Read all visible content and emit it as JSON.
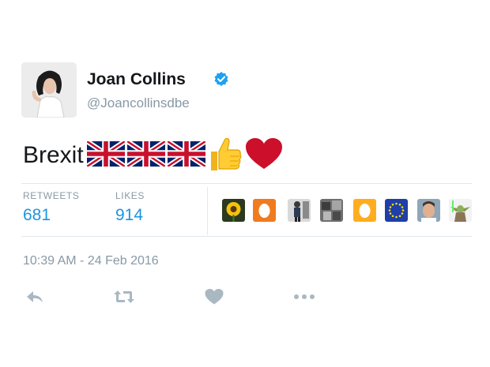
{
  "tweet": {
    "author": {
      "display_name": "Joan Collins",
      "handle": "@Joancollinsdbe",
      "verified": true,
      "avatar_icon": "profile-photo"
    },
    "text": "Brexit",
    "emojis": [
      "uk-flag-icon",
      "uk-flag-icon",
      "uk-flag-icon",
      "thumbs-up-icon",
      "red-heart-icon"
    ],
    "stats": {
      "retweets_label": "RETWEETS",
      "retweets_value": "681",
      "likes_label": "LIKES",
      "likes_value": "914"
    },
    "likers": [
      "sunflower",
      "egg-orange",
      "person-standing",
      "greyscale-photo",
      "egg-yellow",
      "eu-flag",
      "man-face",
      "yoda"
    ],
    "timestamp": "10:39 AM - 24 Feb 2016",
    "actions": [
      "reply-icon",
      "retweet-icon",
      "like-icon",
      "more-icon"
    ]
  },
  "colors": {
    "link_blue": "#1b95e0",
    "muted_grey": "#8899a6",
    "divider": "#e1e8ed",
    "heart_red": "#cc0f2b"
  }
}
